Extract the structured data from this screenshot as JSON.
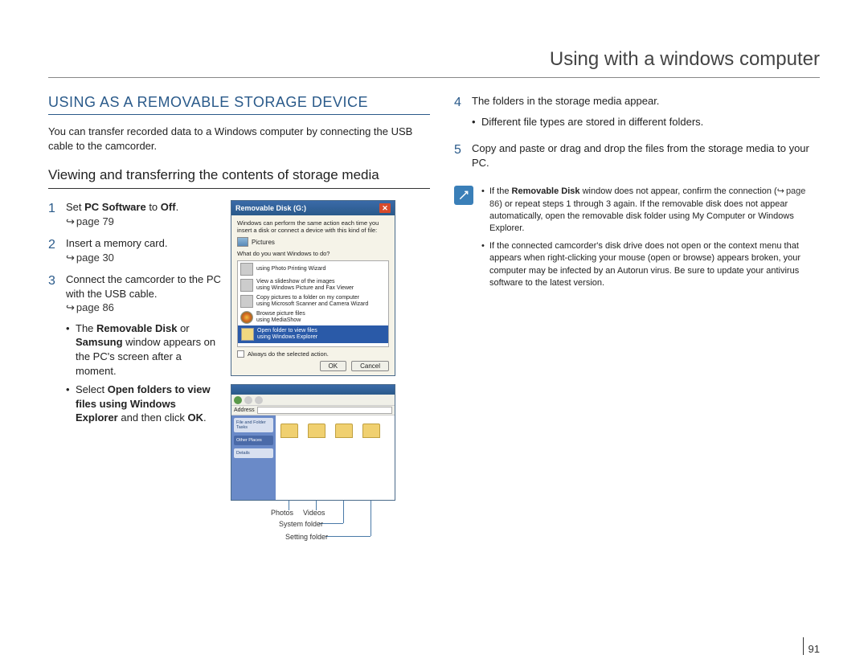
{
  "page": {
    "title": "Using with a windows computer",
    "number": "91"
  },
  "left": {
    "section_title": "USING AS A REMOVABLE STORAGE DEVICE",
    "intro": "You can transfer recorded data to a Windows computer by connecting the USB cable to the camcorder.",
    "subsection_title": "Viewing and transferring the contents of storage media",
    "steps": {
      "s1": {
        "num": "1",
        "text_a": "Set ",
        "bold_a": "PC Software",
        "text_b": " to ",
        "bold_b": "Off",
        "text_c": ".",
        "ref": "page 79"
      },
      "s2": {
        "num": "2",
        "text": "Insert a memory card.",
        "ref": "page 30"
      },
      "s3": {
        "num": "3",
        "text": "Connect the camcorder to the PC with the USB cable.",
        "ref": "page 86"
      }
    },
    "sub": {
      "b1": {
        "t1": "The ",
        "bold1": "Removable Disk",
        "t2": " or ",
        "bold2": "Samsung",
        "t3": " window appears on the PC's screen after a moment."
      },
      "b2": {
        "t1": "Select ",
        "bold1": "Open folders to view files using Windows Explorer",
        "t2": " and then click ",
        "bold2": "OK",
        "t3": "."
      }
    }
  },
  "right": {
    "steps": {
      "s4": {
        "num": "4",
        "text": "The folders in the storage media appear.",
        "bullet": "Different file types are stored in different folders."
      },
      "s5": {
        "num": "5",
        "text": "Copy and paste or drag and drop the files from the storage media to your PC."
      }
    },
    "note": {
      "n1": {
        "t1": "If the ",
        "bold": "Removable Disk",
        "t2": " window does not appear, confirm the connection (",
        "ref": "page 86",
        "t3": ") or repeat steps 1 through 3 again. If the removable disk does not appear automatically, open the removable disk folder using My Computer or Windows Explorer."
      },
      "n2": "If the connected camcorder's disk drive does not open or the context menu that appears when right-clicking your mouse (open or browse) appears broken, your computer may be infected by an Autorun virus. Be sure to update your antivirus software to the latest version."
    }
  },
  "dialog": {
    "title": "Removable Disk (G:)",
    "intro": "Windows can perform the same action each time you insert a disk or connect a device with this kind of file:",
    "pictures_label": "Pictures",
    "prompt": "What do you want Windows to do?",
    "opts": {
      "o1": {
        "main": "using Photo Printing Wizard"
      },
      "o2": {
        "main": "View a slideshow of the images",
        "sub": "using Windows Picture and Fax Viewer"
      },
      "o3": {
        "main": "Copy pictures to a folder on my computer",
        "sub": "using Microsoft Scanner and Camera Wizard"
      },
      "o4": {
        "main": "Browse picture files",
        "sub": "using MediaShow"
      },
      "o5": {
        "main": "Open folder to view files",
        "sub": "using Windows Explorer"
      }
    },
    "check": "Always do the selected action.",
    "ok": "OK",
    "cancel": "Cancel"
  },
  "callouts": {
    "photos": "Photos",
    "videos": "Videos",
    "system": "System folder",
    "setting": "Setting folder"
  }
}
